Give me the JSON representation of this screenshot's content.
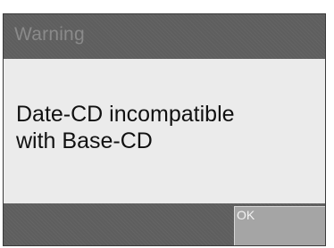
{
  "dialog": {
    "title": "Warning",
    "message_lines": [
      "Date-CD incompatible",
      "with Base-CD"
    ],
    "ok_label": "OK"
  },
  "colors": {
    "bar": "#5e5e5e",
    "body": "#ebebeb",
    "button": "#a5a5a5"
  }
}
